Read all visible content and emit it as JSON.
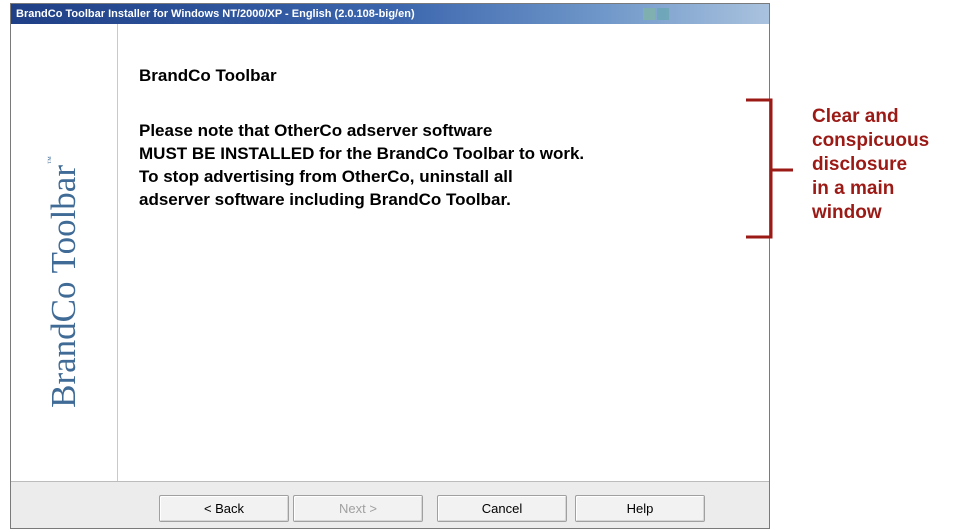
{
  "window": {
    "title": "BrandCo Toolbar Installer for Windows NT/2000/XP - English   (2.0.108-big/en)"
  },
  "sidebar": {
    "brand": "BrandCo Toolbar",
    "trademark": "™"
  },
  "content": {
    "heading": "BrandCo Toolbar",
    "notice_lines": [
      "Please note that OtherCo adserver software",
      "MUST BE INSTALLED for the BrandCo Toolbar to work.",
      "To stop advertising from OtherCo, uninstall all",
      "adserver software including BrandCo Toolbar."
    ]
  },
  "footer": {
    "back_label": "< Back",
    "next_label": "Next >",
    "cancel_label": "Cancel",
    "help_label": "Help"
  },
  "annotation": {
    "lines": [
      "Clear and",
      "conspicuous",
      "disclosure",
      "in a main",
      "window"
    ],
    "color": "#9b1a16"
  },
  "colors": {
    "titlebar_start": "#1f3f86",
    "brand_text": "#3f6b96"
  }
}
